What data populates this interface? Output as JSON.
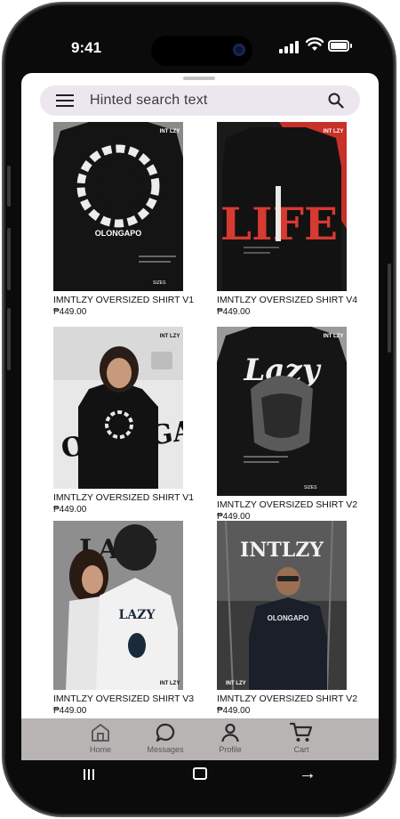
{
  "status_bar": {
    "time": "9:41"
  },
  "search": {
    "placeholder": "Hinted search text"
  },
  "products": [
    {
      "title": "IMNTLZY OVERSIZED SHIRT V1",
      "price": "₱449.00",
      "print": "OLONGAPO",
      "badge": "INT LZY",
      "sizes": "SIZES"
    },
    {
      "title": "IMNTLZY OVERSIZED SHIRT V4",
      "price": "₱449.00",
      "print": "LIFE",
      "badge": "INT LZY",
      "sizes": ""
    },
    {
      "title": "IMNTLZY OVERSIZED SHIRT V1",
      "price": "₱449.00",
      "print": "OLONGAPO",
      "badge": "INT LZY",
      "sizes": ""
    },
    {
      "title": "IMNTLZY OVERSIZED SHIRT V2",
      "price": "₱449.00",
      "print": "Lazy",
      "badge": "INT LZY",
      "sizes": "SIZES"
    },
    {
      "title": "IMNTLZY OVERSIZED SHIRT V3",
      "price": "₱449.00",
      "print": "LAZY",
      "badge": "INT LZY",
      "sizes": ""
    },
    {
      "title": "IMNTLZY OVERSIZED SHIRT V2",
      "price": "₱449.00",
      "print": "INTLZY",
      "badge": "INT LZY",
      "sizes": ""
    }
  ],
  "nav": [
    {
      "label": "Home",
      "icon": "home-icon"
    },
    {
      "label": "Messages",
      "icon": "messages-icon"
    },
    {
      "label": "Profile",
      "icon": "profile-icon"
    },
    {
      "label": "Cart",
      "icon": "cart-icon"
    }
  ],
  "colors": {
    "nav_bg": "#b8b4b4",
    "search_bg": "#ece7ef",
    "accent_red": "#c8312a"
  }
}
